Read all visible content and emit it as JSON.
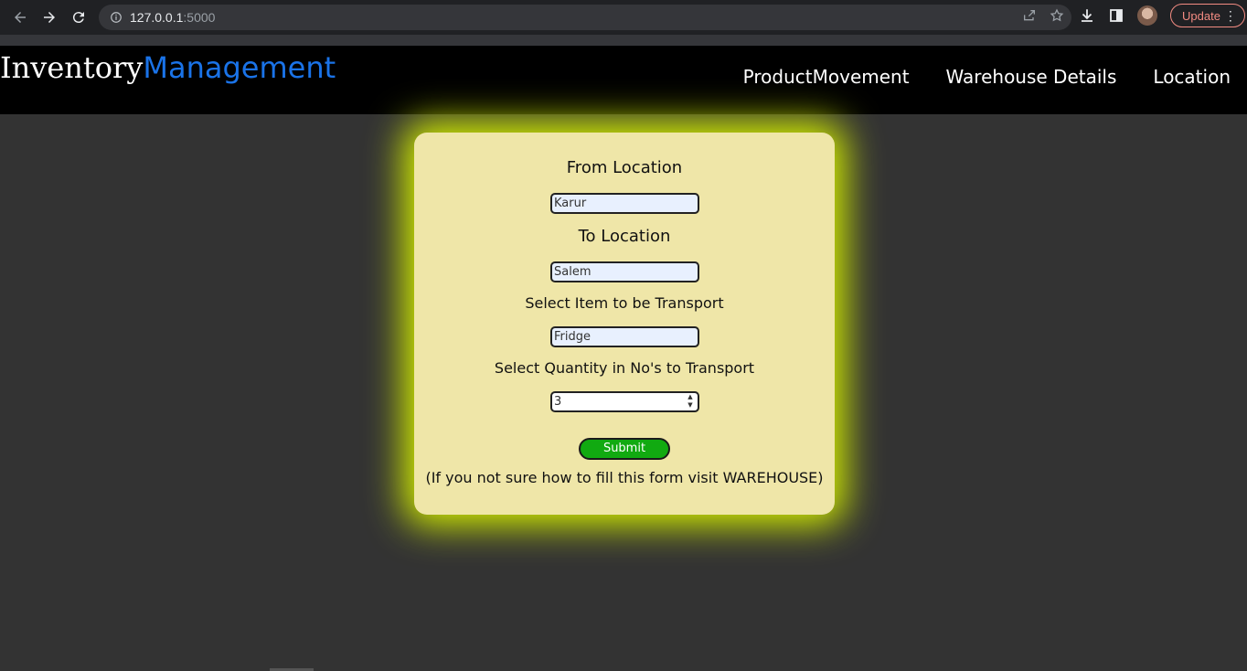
{
  "browser": {
    "url_host": "127.0.0.1",
    "url_port": ":5000",
    "update_label": "Update",
    "menu_glyph": "⋮"
  },
  "header": {
    "logo_part1": "Inventory",
    "logo_part2": "Management",
    "nav": [
      {
        "label": "ProductMovement"
      },
      {
        "label": "Warehouse Details"
      },
      {
        "label": "Location"
      }
    ]
  },
  "form": {
    "from_label": "From Location",
    "from_value": "Karur",
    "to_label": "To Location",
    "to_value": "Salem",
    "item_label": "Select Item to be Transport",
    "item_value": "Fridge",
    "qty_label": "Select Quantity in No's to Transport",
    "qty_value": "3",
    "submit_label": "Submit",
    "hint": "(If you not sure how to fill this form visit WAREHOUSE)"
  },
  "colors": {
    "page_bg": "#333333",
    "header_bg": "#000000",
    "card_bg": "#efe6a8",
    "card_glow": "#d4ef00",
    "accent_blue": "#1a73e8",
    "submit_green": "#11aa11"
  }
}
